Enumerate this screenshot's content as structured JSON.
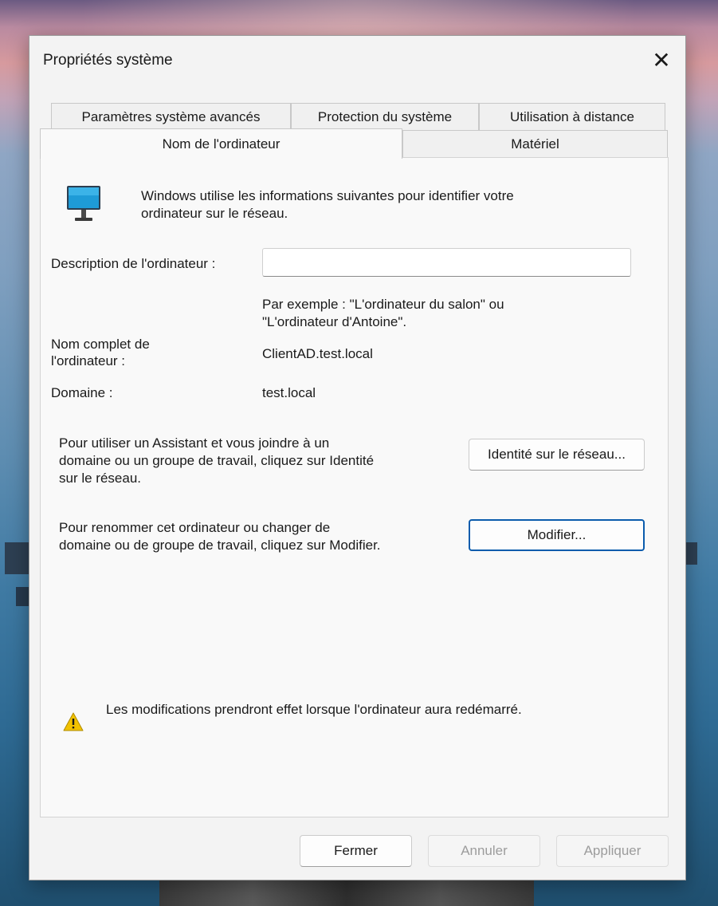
{
  "dialog": {
    "title": "Propriétés système",
    "close_glyph": "✕"
  },
  "tabs": {
    "advanced": "Paramètres système avancés",
    "protection": "Protection du système",
    "remote": "Utilisation à distance",
    "computer_name": "Nom de l'ordinateur",
    "hardware": "Matériel"
  },
  "active_tab": "computer_name",
  "intro": {
    "icon": "monitor-icon",
    "line1": "Windows utilise les informations suivantes pour identifier votre",
    "line2": "ordinateur sur le réseau."
  },
  "description": {
    "label": "Description de l'ordinateur :",
    "value": "",
    "example_line1": "Par exemple : \"L'ordinateur du salon\" ou",
    "example_line2": "\"L'ordinateur d'Antoine\"."
  },
  "full_name": {
    "label_line1": "Nom complet de",
    "label_line2": "l'ordinateur :",
    "value": "ClientAD.test.local"
  },
  "domain": {
    "label": "Domaine :",
    "value": "test.local"
  },
  "network_id": {
    "text_line1": "Pour utiliser un Assistant et vous joindre à un",
    "text_line2": "domaine ou un groupe de travail, cliquez sur Identité",
    "text_line3": "sur le réseau.",
    "button_label": "Identité sur le réseau..."
  },
  "rename": {
    "text_line1": "Pour renommer cet ordinateur ou changer de",
    "text_line2": "domaine ou de groupe de travail, cliquez sur Modifier.",
    "button_label": "Modifier..."
  },
  "warning": {
    "icon": "warning-icon",
    "text": "Les modifications prendront effet lorsque l'ordinateur aura redémarré."
  },
  "footer": {
    "close_label": "Fermer",
    "cancel_label": "Annuler",
    "apply_label": "Appliquer"
  },
  "colors": {
    "focus_border": "#0b5cad",
    "warning_yellow": "#f2c200",
    "monitor_screen": "#1e9bd7"
  }
}
